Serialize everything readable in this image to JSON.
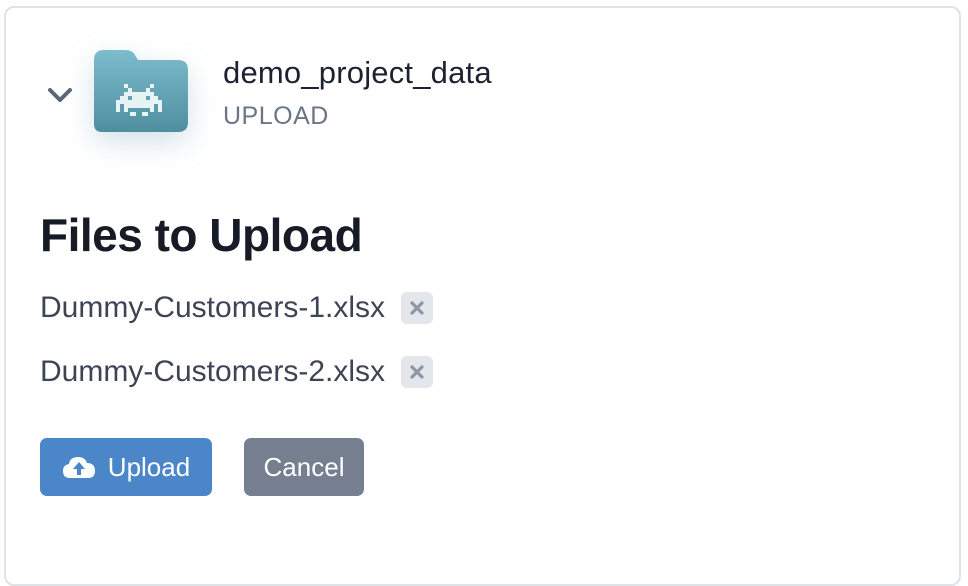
{
  "project": {
    "name": "demo_project_data",
    "mode_label": "UPLOAD",
    "folder_icon": "folder-space-invader-icon",
    "folder_color": "#5fa3b3"
  },
  "section": {
    "title": "Files to Upload"
  },
  "files": [
    {
      "name": "Dummy-Customers-1.xlsx",
      "remove_icon": "close-icon"
    },
    {
      "name": "Dummy-Customers-2.xlsx",
      "remove_icon": "close-icon"
    }
  ],
  "actions": {
    "upload_label": "Upload",
    "upload_icon": "cloud-upload-icon",
    "cancel_label": "Cancel",
    "upload_color": "#4a86c8",
    "cancel_color": "#757f8f"
  },
  "collapse_icon": "chevron-down-icon"
}
